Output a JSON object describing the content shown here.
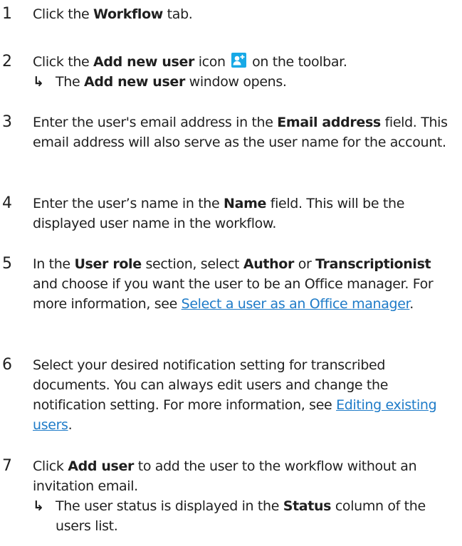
{
  "steps": [
    {
      "number": "1",
      "text": {
        "pre": "Click the ",
        "bold": "Workflow",
        "post": " tab."
      }
    },
    {
      "number": "2",
      "text": {
        "pre": "Click the ",
        "bold": "Add new user",
        "mid": " icon ",
        "post": " on the toolbar."
      },
      "icon": "add-user-icon",
      "result": {
        "pre": "The ",
        "bold": "Add new user",
        "post": " window opens."
      }
    },
    {
      "number": "3",
      "text": {
        "pre": "Enter the user's email address in the ",
        "bold": "Email address",
        "post": " field. This email address will also serve as the user name for the account."
      }
    },
    {
      "number": "4",
      "text": {
        "pre": "Enter the user’s name in the ",
        "bold": "Name",
        "post": " field. This will be the displayed user name in the workflow."
      }
    },
    {
      "number": "5",
      "text": {
        "pre": "In the ",
        "bold1": "User role",
        "mid1": " section, select ",
        "bold2": "Author",
        "mid2": " or ",
        "bold3": "Transcriptionist",
        "post": " and choose if you want the user to be an Office manager. For more information, see "
      },
      "link": "Select a user as an Office manager",
      "link_after": "."
    },
    {
      "number": "6",
      "text": {
        "pre": "Select your desired notification setting for transcribed documents. You can always edit users and change the notification setting. For more information, see "
      },
      "link": "Editing existing users",
      "link_after": "."
    },
    {
      "number": "7",
      "text": {
        "pre": "Click ",
        "bold": "Add user",
        "post": " to add the user to the workflow without an invitation email."
      },
      "result": {
        "pre": "The user status is displayed in the ",
        "bold": "Status",
        "post": " column of the users list."
      }
    }
  ],
  "arrow_glyph": "↳",
  "colors": {
    "text": "#1f1f1f",
    "link": "#1e7bc8",
    "icon_bg": "#17a9e6"
  }
}
